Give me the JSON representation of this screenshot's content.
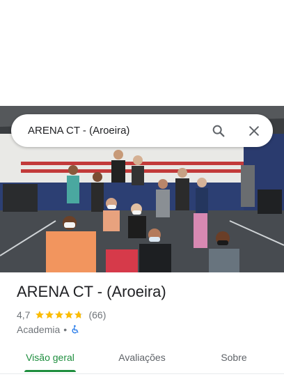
{
  "search": {
    "query": "ARENA CT - (Aroeira)"
  },
  "place": {
    "title": "ARENA CT - (Aroeira)",
    "rating": "4,7",
    "rating_value": 4.7,
    "review_count": "(66)",
    "category": "Academia",
    "separator": "•"
  },
  "tabs": [
    {
      "label": "Visão geral",
      "active": true
    },
    {
      "label": "Avaliações",
      "active": false
    },
    {
      "label": "Sobre",
      "active": false
    }
  ],
  "colors": {
    "accent": "#1e8e3e",
    "star": "#fbbc04",
    "accessibility": "#1a73e8"
  },
  "icons": {
    "search": "search-icon",
    "close": "close-icon",
    "star": "star-icon",
    "accessibility": "wheelchair-icon"
  }
}
